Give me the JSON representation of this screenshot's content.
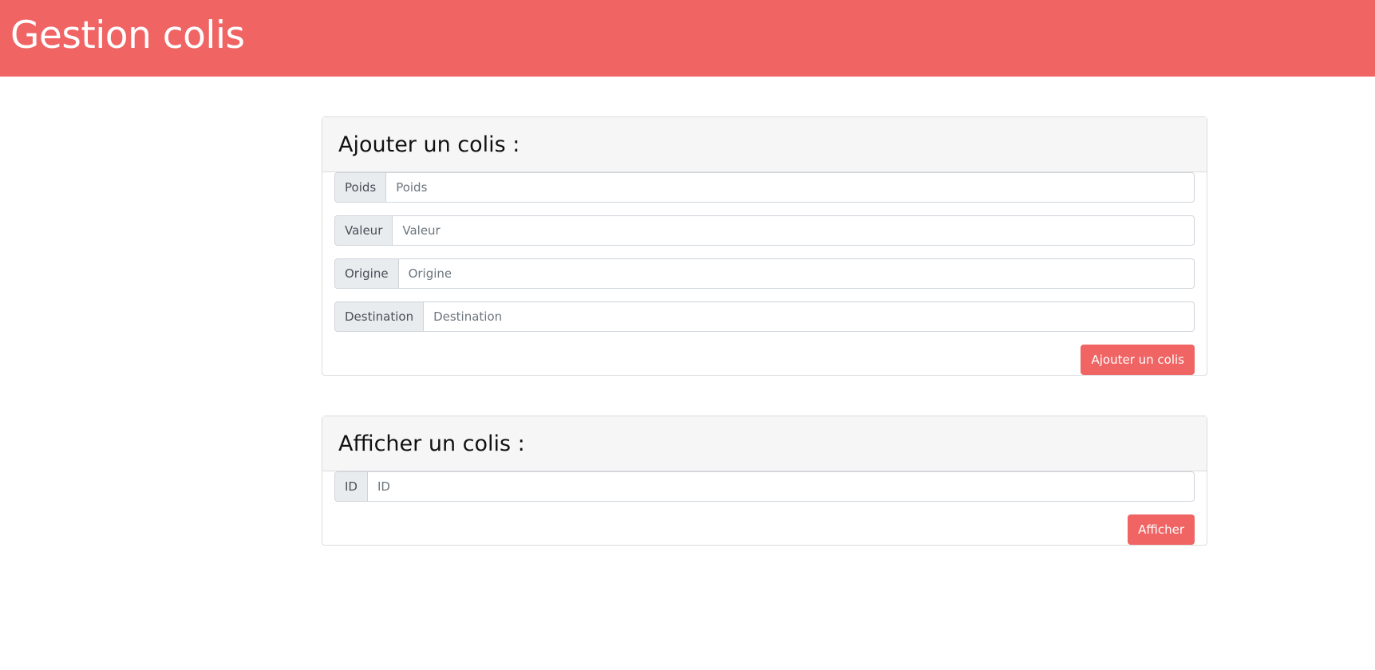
{
  "header": {
    "title": "Gestion colis"
  },
  "add_card": {
    "title": "Ajouter un colis :",
    "fields": [
      {
        "label": "Poids",
        "placeholder": "Poids"
      },
      {
        "label": "Valeur",
        "placeholder": "Valeur"
      },
      {
        "label": "Origine",
        "placeholder": "Origine"
      },
      {
        "label": "Destination",
        "placeholder": "Destination"
      }
    ],
    "button": "Ajouter un colis"
  },
  "show_card": {
    "title": "Afficher un colis :",
    "fields": [
      {
        "label": "ID",
        "placeholder": "ID"
      }
    ],
    "button": "Afficher"
  },
  "colors": {
    "accent": "#f06464"
  }
}
